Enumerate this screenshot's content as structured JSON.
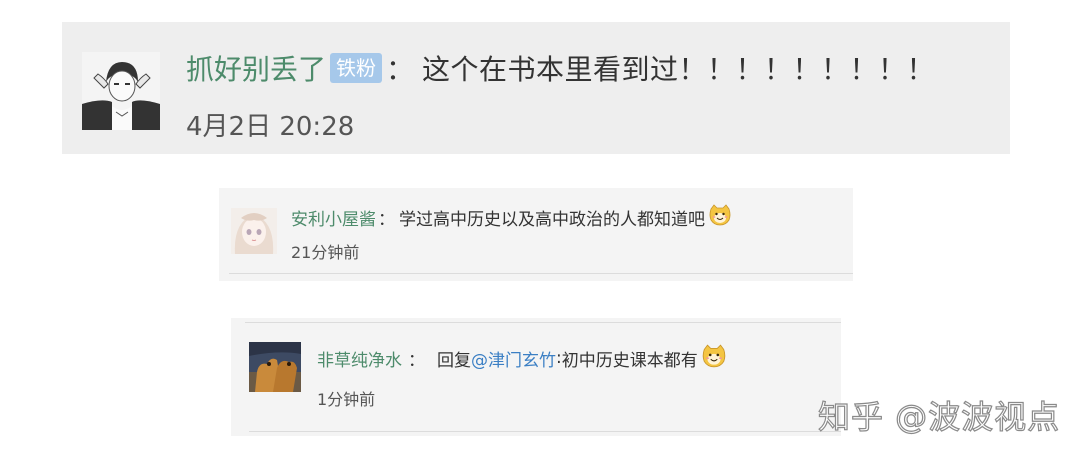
{
  "comments": [
    {
      "username": "抓好别丢了",
      "badge": "铁粉",
      "separator": "：",
      "text": "这个在书本里看到过！！！！！！！！！",
      "time": "4月2日 20:28",
      "avatar_icon": "avatar-sketch-portrait"
    },
    {
      "username": "安利小屋酱",
      "separator": "：",
      "text": "学过高中历史以及高中政治的人都知道吧",
      "time": "21分钟前",
      "avatar_icon": "avatar-anime-girl",
      "emoji": "smiling-cat-face-icon"
    },
    {
      "username": "非草纯净水",
      "separator": "：",
      "reply_prefix": "回复",
      "mention": "@津门玄竹",
      "reply_colon": ":",
      "text": "初中历史课本都有",
      "time": "1分钟前",
      "avatar_icon": "avatar-camels-photo",
      "emoji": "smiling-cat-face-icon"
    }
  ],
  "watermark": "知乎 @波波视点",
  "colors": {
    "username": "#4d8b6b",
    "mention": "#3b7fc4",
    "badge_bg": "#a6c8ea",
    "card_bg": "#eeeeee"
  }
}
